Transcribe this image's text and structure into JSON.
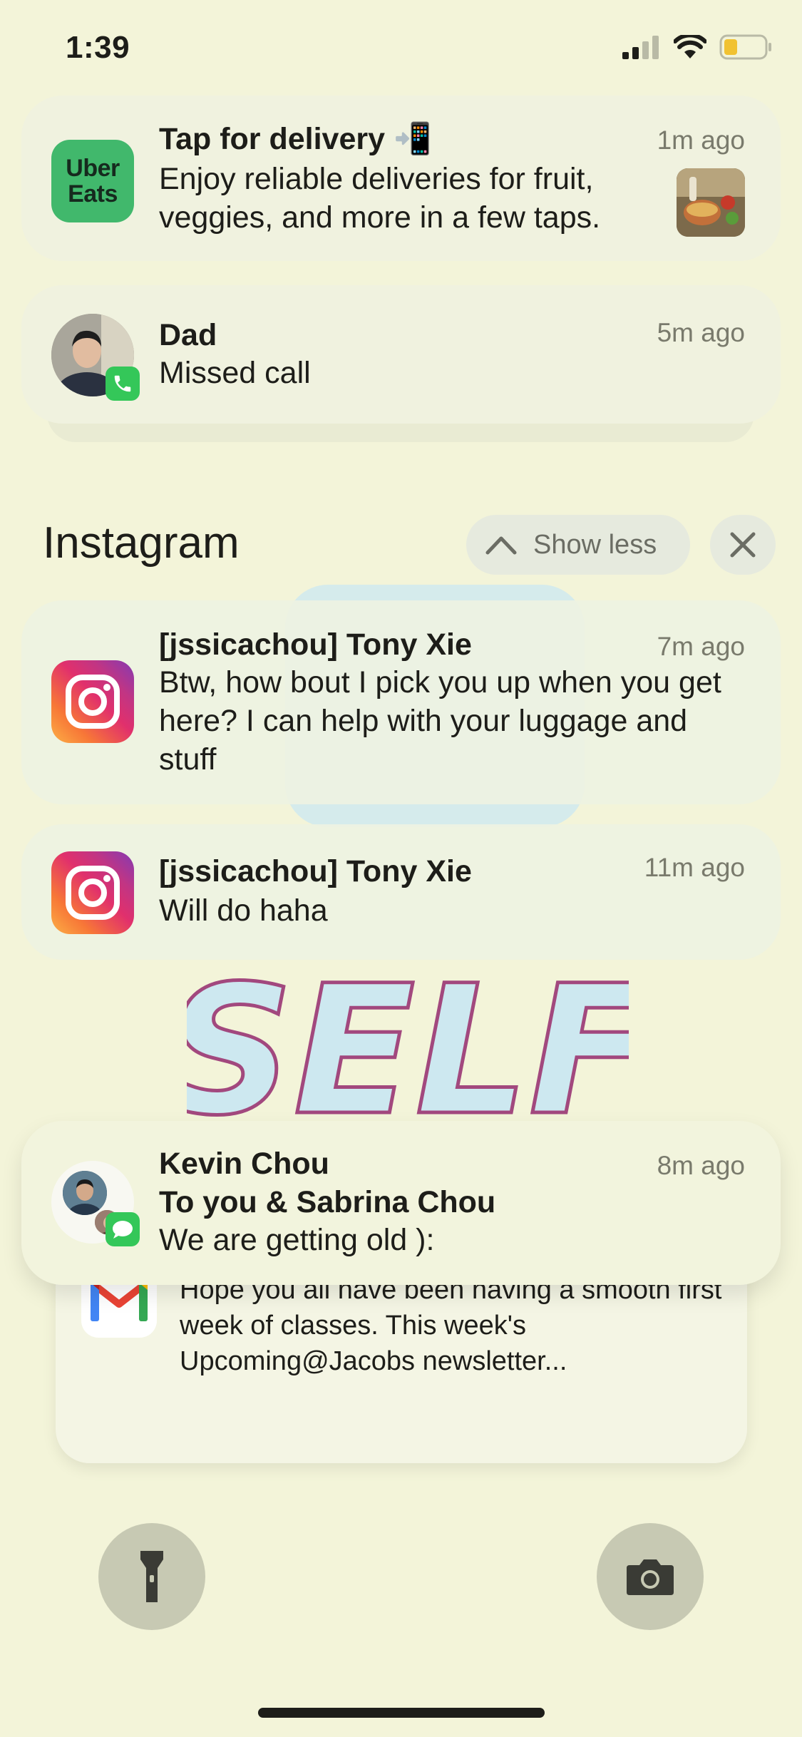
{
  "status_bar": {
    "time": "1:39"
  },
  "notifications": {
    "uber": {
      "title": "Tap for delivery 📲",
      "time": "1m ago",
      "body": "Enjoy reliable deliveries for fruit, veggies, and more in a few taps.",
      "logo_line1": "Uber",
      "logo_line2": "Eats"
    },
    "dad": {
      "title": "Dad",
      "time": "5m ago",
      "body": "Missed call"
    },
    "instagram_group": {
      "app_name": "Instagram",
      "show_less_label": "Show less",
      "items": [
        {
          "title": "[jssicachou] Tony Xie",
          "time": "7m ago",
          "body": "Btw, how bout I pick you up when you get here? I can help with your luggage and stuff"
        },
        {
          "title": "[jssicachou] Tony Xie",
          "time": "11m ago",
          "body": "Will do haha"
        }
      ]
    },
    "kevin": {
      "title": "Kevin Chou",
      "subtitle": "To you & Sabrina Chou",
      "time": "8m ago",
      "body": "We are getting old ):"
    },
    "gmail": {
      "body_partial": "Dear Jacobs Community, Welcome back! Hope you all have been having a smooth first week of classes. This week's Upcoming@Jacobs newsletter..."
    }
  },
  "wallpaper": {
    "text": "SELF"
  },
  "colors": {
    "background": "#f3f4d9",
    "card": "#f0f2df",
    "uber_green": "#41b86c",
    "phone_badge": "#34c759",
    "wallpaper_text": "#cde8f0"
  }
}
